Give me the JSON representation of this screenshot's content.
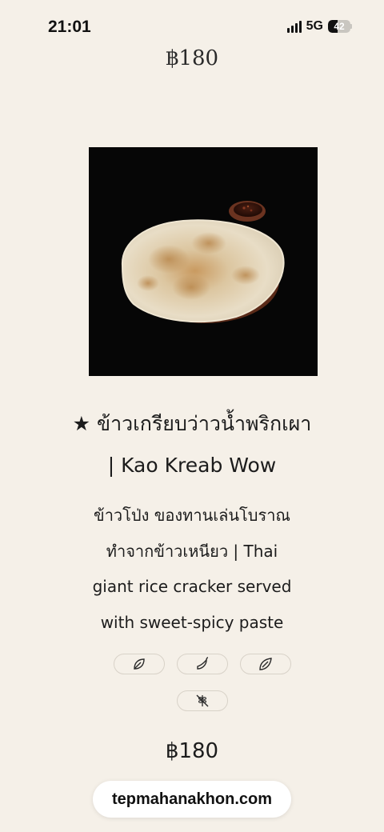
{
  "status_bar": {
    "time": "21:01",
    "network": "5G",
    "battery_level": "42",
    "battery_percent": 42
  },
  "previous_item": {
    "price": "฿180"
  },
  "item": {
    "image_icon": "rice-cracker-photo",
    "title": "★ ข้าวเกรียบว่าวน้ำพริกเผา | Kao Kreab Wow",
    "description": "ข้าวโป่ง ของทานเล่นโบราณ ทำจากข้าวเหนียว | Thai giant rice cracker served with sweet-spicy paste",
    "dietary_icons": [
      "vegetarian-leaf-icon",
      "chili-icon",
      "vegan-leaf-icon",
      "gluten-free-icon"
    ],
    "price": "฿180"
  },
  "browser": {
    "url": "tepmahanakhon.com"
  },
  "colors": {
    "background": "#f5f0e8",
    "text": "#1c1c1c",
    "pill_border": "#d8d2c8",
    "image_background": "#060606"
  }
}
